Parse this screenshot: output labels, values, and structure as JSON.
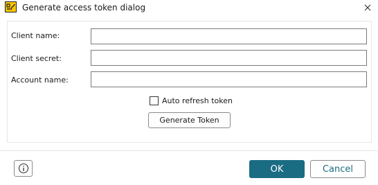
{
  "window": {
    "title": "Generate access token dialog",
    "app_icon": "app-logo-icon",
    "close_icon": "close-icon"
  },
  "form": {
    "fields": [
      {
        "label": "Client name:",
        "value": ""
      },
      {
        "label": "Client secret:",
        "value": ""
      },
      {
        "label": "Account name:",
        "value": ""
      }
    ],
    "auto_refresh": {
      "label": "Auto refresh token",
      "checked": false
    },
    "generate_label": "Generate Token"
  },
  "footer": {
    "info_icon": "info-icon",
    "ok_label": "OK",
    "cancel_label": "Cancel"
  },
  "colors": {
    "accent": "#1a6c83",
    "border": "#7a7a7a",
    "separator": "#e6e6e6"
  }
}
